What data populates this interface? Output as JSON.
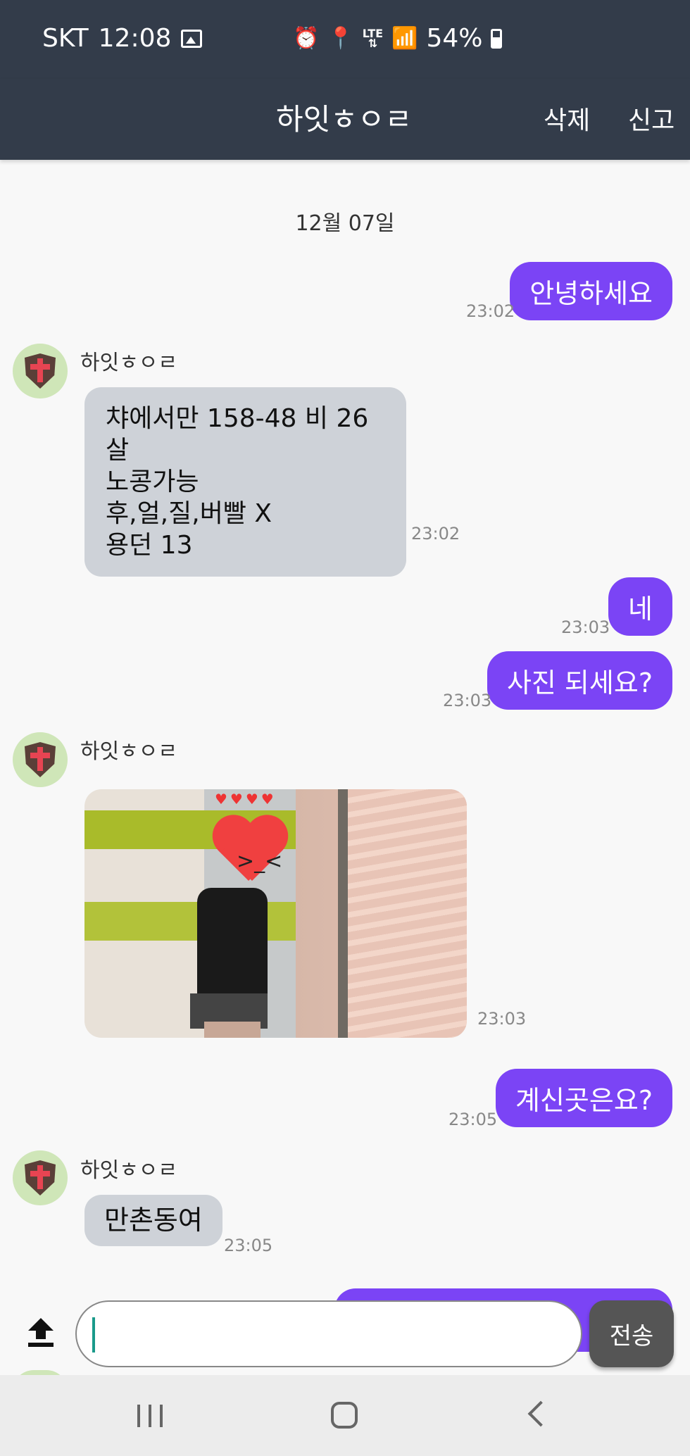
{
  "status_bar": {
    "carrier": "SKT",
    "time": "12:08",
    "network": "LTE",
    "battery": "54%",
    "icons": [
      "image-icon",
      "alarm-icon",
      "location-icon",
      "lte-icon",
      "signal-icon",
      "battery-icon"
    ]
  },
  "header": {
    "title": "하잇ㅎㅇㄹ",
    "delete_label": "삭제",
    "report_label": "신고"
  },
  "chat": {
    "date": "12월 07일",
    "messages": [
      {
        "direction": "out",
        "type": "text",
        "text": "안녕하세요",
        "time": "23:02"
      },
      {
        "direction": "in",
        "type": "text",
        "sender": "하잇ㅎㅇㄹ",
        "text": "챠에서만 158-48 비 26살\n노콩가능\n후,얼,질,버빨 X\n용던 13",
        "time": "23:02"
      },
      {
        "direction": "out",
        "type": "text",
        "text": "네",
        "time": "23:03"
      },
      {
        "direction": "out",
        "type": "text",
        "text": "사진 되세요?",
        "time": "23:03"
      },
      {
        "direction": "in",
        "type": "image",
        "sender": "하잇ㅎㅇㄹ",
        "time": "23:03"
      },
      {
        "direction": "out",
        "type": "text",
        "text": "계신곳은요?",
        "time": "23:05"
      },
      {
        "direction": "in",
        "type": "text",
        "sender": "하잇ㅎㅇㄹ",
        "text": "만촌동여",
        "time": "23:05"
      }
    ]
  },
  "composer": {
    "input_value": "",
    "send_label": "전송"
  },
  "colors": {
    "header_bg": "#333c4a",
    "outgoing_bubble": "#7b44f5",
    "incoming_bubble": "#ced2d8",
    "send_button": "#555555"
  }
}
